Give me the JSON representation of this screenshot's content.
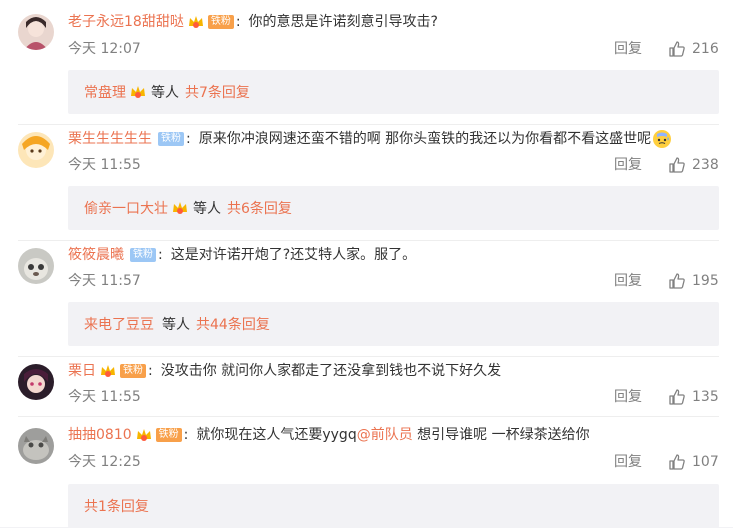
{
  "common": {
    "reply_label": "回复",
    "etc_label": "等人"
  },
  "comments": [
    {
      "username": "老子永远18甜甜哒",
      "badge": "铁粉",
      "text": "你的意思是许诺刻意引导攻击?",
      "time": "今天 12:07",
      "likes": "216",
      "thread": {
        "who": "常盘理",
        "count": "共7条回复"
      }
    },
    {
      "username": "栗生生生生生",
      "badge": "铁粉",
      "text": "原来你冲浪网速还蛮不错的啊 那你头蛮铁的我还以为你看都不看这盛世呢",
      "emoji": "cold-sweat-emoji",
      "time": "今天 11:55",
      "likes": "238",
      "thread": {
        "who": "偷亲一口大壮",
        "count": "共6条回复"
      }
    },
    {
      "username": "筱筱晨曦",
      "badge": "铁粉",
      "text": "这是对许诺开炮了?还艾特人家。服了。",
      "time": "今天 11:57",
      "likes": "195",
      "thread": {
        "who": "来电了豆豆",
        "count": "共44条回复"
      }
    },
    {
      "username": "栗日",
      "badge": "铁粉",
      "text": "没攻击你 就问你人家都走了还没拿到钱也不说下好久发",
      "time": "今天 11:55",
      "likes": "135"
    },
    {
      "username": "抽抽0810",
      "badge": "铁粉",
      "text_before": "就你现在这人气还要yygq",
      "mention": "@前队员",
      "text_after": " 想引导谁呢 一杯绿茶送给你",
      "time": "今天 12:25",
      "likes": "107",
      "thread": {
        "count": "共1条回复"
      }
    }
  ],
  "colors": {
    "accent": "#eb7350",
    "muted": "#808080",
    "thread_bg": "#f2f2f5",
    "badge_blue": "#9cc7f5",
    "badge_orange": "#f8a04a"
  }
}
